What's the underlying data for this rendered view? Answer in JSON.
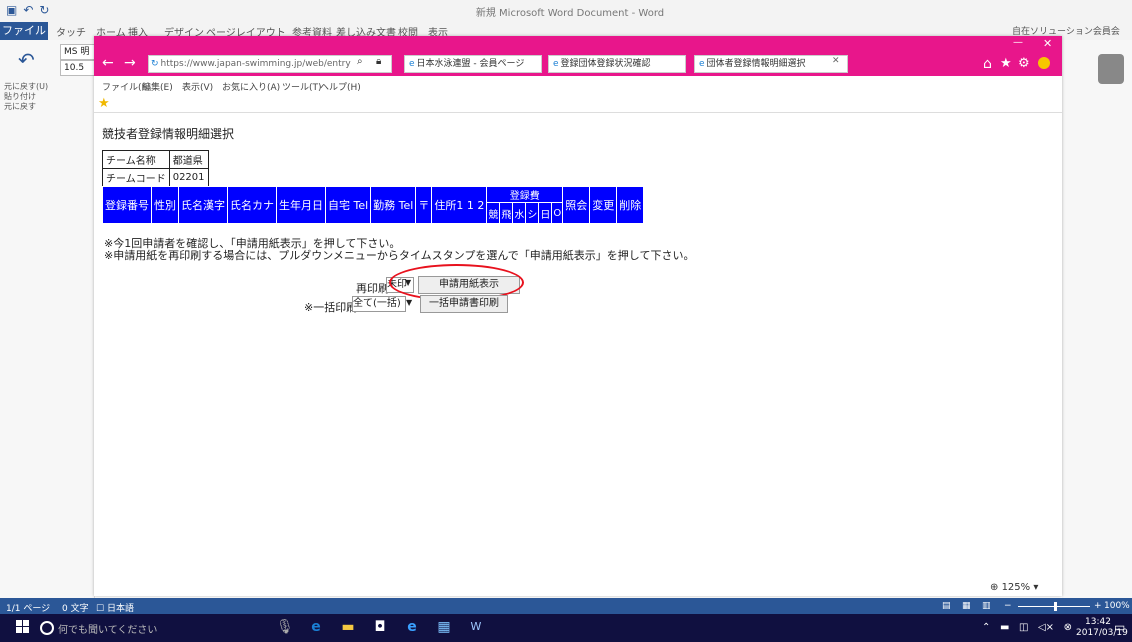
{
  "word": {
    "title": "新規 Microsoft Word Document - Word",
    "file_tab": "ファイル",
    "ribbon_tabs": [
      "タッチ",
      "ホーム",
      "挿入",
      "デザイン",
      "ページレイアウト",
      "参考資料",
      "差し込み文書",
      "校閲",
      "表示"
    ],
    "font_box": "MS 明",
    "size_box": "10.5",
    "side_labels": [
      "元に戻す(U)",
      "貼り付け",
      "元に戻す"
    ],
    "user": "自在ソリューション会員会",
    "status": {
      "page": "1/1 ページ",
      "words": "0 文字",
      "lang": "日本語",
      "zoom": "100%"
    }
  },
  "ie": {
    "url": "https://www.japan-swimming.jp/web/entry",
    "tabs": [
      {
        "label": "日本水泳連盟 - 会員ページ"
      },
      {
        "label": "登録団体登録状況確認"
      },
      {
        "label": "団体者登録情報明細選択"
      }
    ],
    "menu": [
      "ファイル(F)",
      "編集(E)",
      "表示(V)",
      "お気に入り(A)",
      "ツール(T)",
      "ヘルプ(H)"
    ],
    "zoom": "125%"
  },
  "page": {
    "title": "競技者登録情報明細選択",
    "team": {
      "name_label": "チーム名称",
      "name_value": "都道県",
      "code_label": "チームコード",
      "code_value": "02201"
    },
    "table_headers": [
      "登録番号",
      "性別",
      "氏名漢字",
      "氏名カナ",
      "生年月日",
      "自宅 Tel",
      "勤務 Tel",
      "〒",
      "住所1 1 2"
    ],
    "reg_header": "登録費",
    "reg_sub": [
      "競",
      "飛",
      "水",
      "シ",
      "日",
      "O"
    ],
    "tail_headers": [
      "照会",
      "変更",
      "削除"
    ],
    "note1": "※今1回申請者を確認し、「申請用紙表示」を押して下さい。",
    "note2": "※申請用紙を再印刷する場合には、プルダウンメニューからタイムスタンプを選んで「申請用紙表示」を押して下さい。",
    "print": {
      "label": "再印刷",
      "select_value": "未印",
      "button": "申請用紙表示"
    },
    "batch": {
      "label": "※一括印刷",
      "select_value": "全て(一括)",
      "button": "一括申請書印刷"
    }
  },
  "taskbar": {
    "search_placeholder": "何でも聞いてください",
    "time": "13:42",
    "date": "2017/03/19"
  },
  "colors": {
    "ie_chrome": "#e8168b",
    "table_blue": "#0000ff",
    "highlight": "#e8111d",
    "word_blue": "#2b5797",
    "taskbar": "#101040"
  }
}
